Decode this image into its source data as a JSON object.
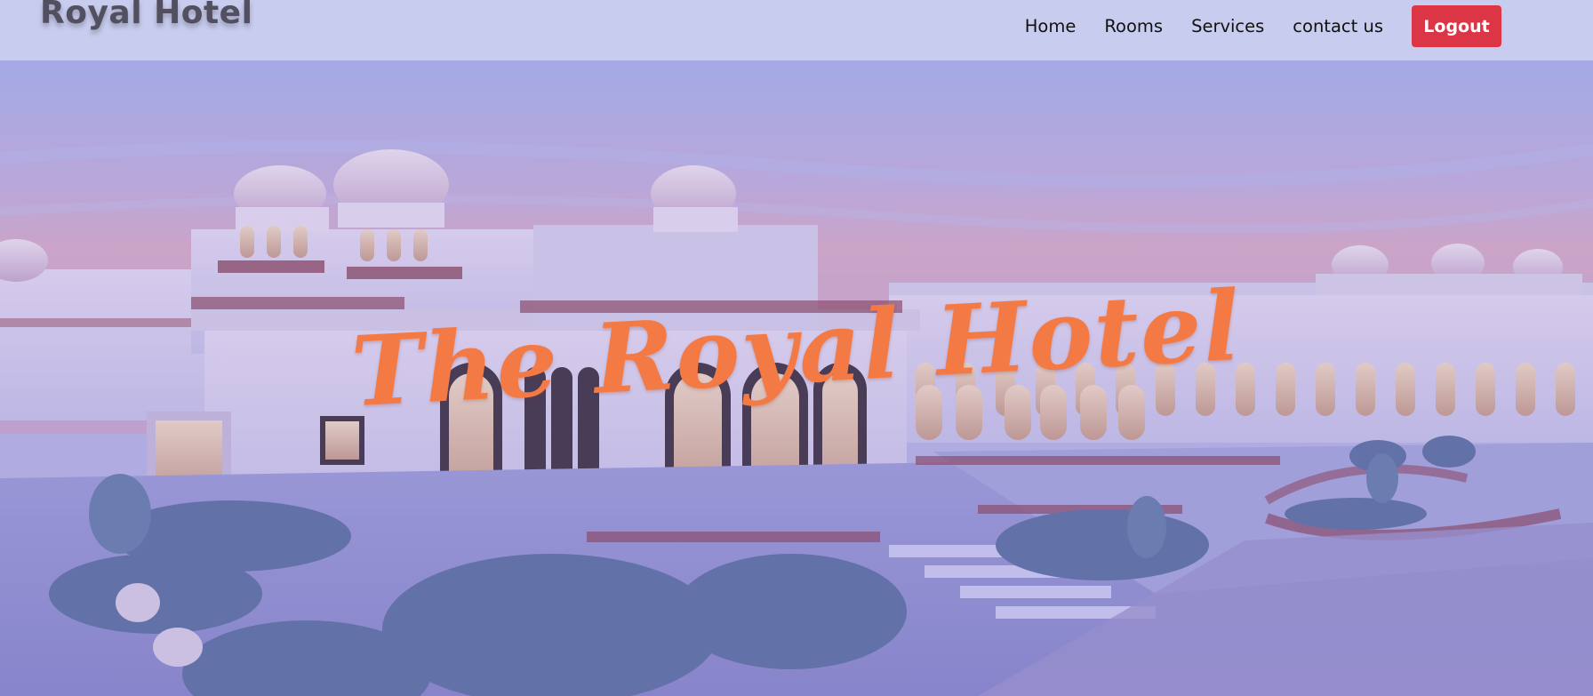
{
  "brand": {
    "name": "Royal Hotel"
  },
  "nav": {
    "links": [
      "Home",
      "Rooms",
      "Services",
      "contact us"
    ],
    "logout_label": "Logout"
  },
  "hero": {
    "title": "The Royal Hotel",
    "image": "palace-hotel-photo"
  },
  "colors": {
    "navbar_bg": "#c8cdef",
    "logout_bg": "#dc3545",
    "hero_title": "#f47a45",
    "overlay": "#8c8ee0"
  }
}
